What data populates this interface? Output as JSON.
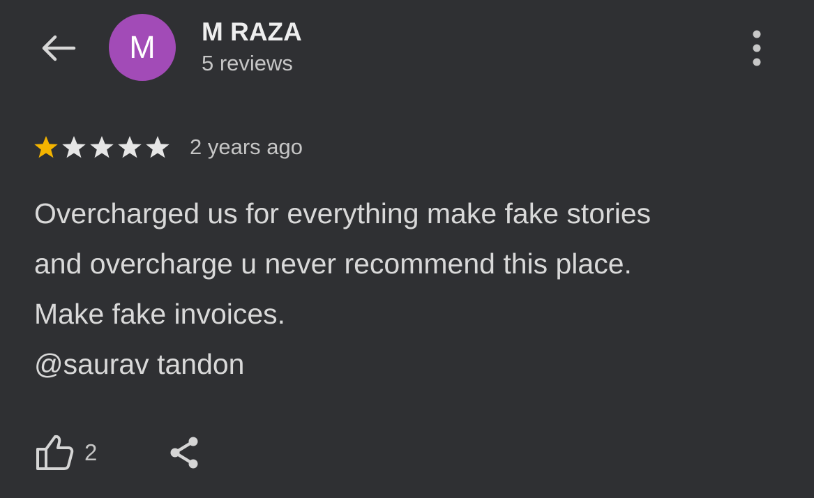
{
  "header": {
    "avatar_letter": "M",
    "reviewer_name": "M RAZA",
    "review_count": "5 reviews"
  },
  "review": {
    "rating": 1,
    "rating_max": 5,
    "date": "2 years ago",
    "text": "Overcharged us for everything make fake stories\nand overcharge u never recommend this place.\nMake fake invoices.\n@saurav tandon"
  },
  "actions": {
    "like_count": "2"
  },
  "icons": {
    "back": "arrow-left-icon",
    "more": "more-vertical-icon",
    "star": "star-icon",
    "like": "thumb-up-icon",
    "share": "share-icon"
  },
  "colors": {
    "background": "#2f3033",
    "avatar": "#a24bb7",
    "star_filled": "#f4b400",
    "star_empty": "#e6e6e6",
    "text": "#d9d9d9",
    "secondary_text": "#c6c6c6"
  }
}
